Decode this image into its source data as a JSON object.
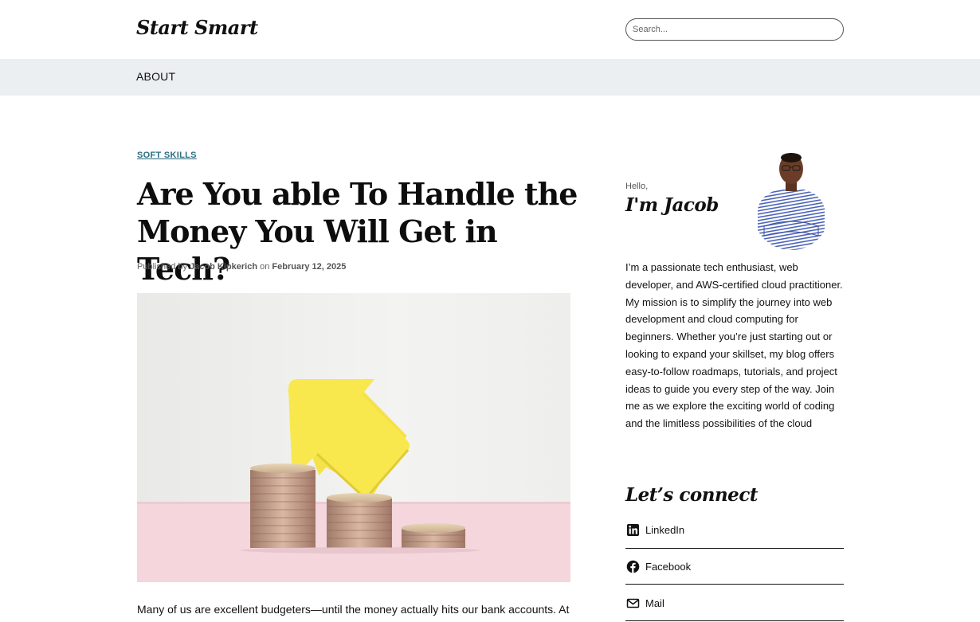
{
  "header": {
    "site_title": "Start Smart",
    "search_placeholder": "Search..."
  },
  "nav": {
    "items": [
      {
        "label": "ABOUT"
      }
    ]
  },
  "post": {
    "category": "SOFT SKILLS",
    "title": "Are You able To Handle the Money You Will Get in Tech?",
    "meta_published_by": "Published by",
    "author": "Jacob Kipkerich",
    "meta_on": "on",
    "date": "February 12, 2025",
    "excerpt": "Many of us are excellent budgeters—until the money actually hits our bank accounts. At"
  },
  "sidebar": {
    "hello": "Hello,",
    "name_heading": "I'm Jacob",
    "bio": "I’m a passionate tech enthusiast, web developer, and AWS-certified cloud practitioner. My mission is to simplify the journey into web development and cloud computing for beginners. Whether you’re just starting out or looking to expand your skillset, my blog offers easy-to-follow roadmaps, tutorials, and project ideas to guide you every step of the way. Join me as we explore the exciting world of coding and the limitless possibilities of the cloud",
    "connect_heading": "Let’s connect",
    "social": [
      {
        "label": "LinkedIn",
        "icon": "linkedin-icon"
      },
      {
        "label": "Facebook",
        "icon": "facebook-icon"
      },
      {
        "label": "Mail",
        "icon": "mail-icon"
      }
    ]
  },
  "colors": {
    "nav_bg": "#eceff1",
    "category_link": "#2a6e80",
    "text": "#111111",
    "hero_arrow": "#f7e64a",
    "hero_base": "#f4d6dc"
  }
}
